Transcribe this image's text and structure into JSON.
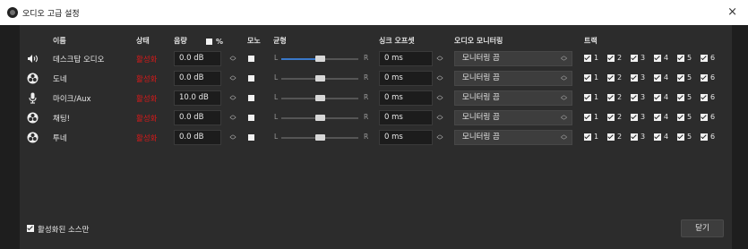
{
  "window": {
    "title": "오디오 고급 설정",
    "close_glyph": "×"
  },
  "headers": {
    "name": "이름",
    "status": "상태",
    "volume": "음량",
    "percent": "%",
    "mono": "모노",
    "balance": "균형",
    "sync_offset": "싱크 오프셋",
    "audio_monitoring": "오디오 모니터링",
    "tracks": "트랙"
  },
  "balance_labels": {
    "left": "L",
    "right": "R"
  },
  "spin_glyphs": {
    "up": "︿",
    "down": "﹀"
  },
  "rows": [
    {
      "icon": "speaker-icon",
      "name": "데스크탑 오디오",
      "status": "활성화",
      "volume": "0.0 dB",
      "mono": false,
      "balance": 0.5,
      "balance_active": true,
      "sync_offset": "0 ms",
      "monitoring": "모니터링 끔",
      "tracks": [
        "1",
        "2",
        "3",
        "4",
        "5",
        "6"
      ]
    },
    {
      "icon": "obs-icon",
      "name": "도네",
      "status": "활성화",
      "volume": "0.0 dB",
      "mono": false,
      "balance": 0.5,
      "balance_active": false,
      "sync_offset": "0 ms",
      "monitoring": "모니터링 끔",
      "tracks": [
        "1",
        "2",
        "3",
        "4",
        "5",
        "6"
      ]
    },
    {
      "icon": "microphone-icon",
      "name": "마이크/Aux",
      "status": "활성화",
      "volume": "10.0 dB",
      "mono": false,
      "balance": 0.5,
      "balance_active": false,
      "sync_offset": "0 ms",
      "monitoring": "모니터링 끔",
      "tracks": [
        "1",
        "2",
        "3",
        "4",
        "5",
        "6"
      ]
    },
    {
      "icon": "obs-icon",
      "name": "채팅!",
      "status": "활성화",
      "volume": "0.0 dB",
      "mono": false,
      "balance": 0.5,
      "balance_active": false,
      "sync_offset": "0 ms",
      "monitoring": "모니터링 끔",
      "tracks": [
        "1",
        "2",
        "3",
        "4",
        "5",
        "6"
      ]
    },
    {
      "icon": "obs-icon",
      "name": "투네",
      "status": "활성화",
      "volume": "0.0 dB",
      "mono": false,
      "balance": 0.5,
      "balance_active": false,
      "sync_offset": "0 ms",
      "monitoring": "모니터링 끔",
      "tracks": [
        "1",
        "2",
        "3",
        "4",
        "5",
        "6"
      ]
    }
  ],
  "footer": {
    "active_only_label": "활성화된 소스만",
    "active_only_checked": true,
    "close_button": "닫기"
  },
  "colors": {
    "status_red": "#d41a1a",
    "accent_blue": "#3a78c9",
    "window_bg": "#2c2c2c"
  }
}
